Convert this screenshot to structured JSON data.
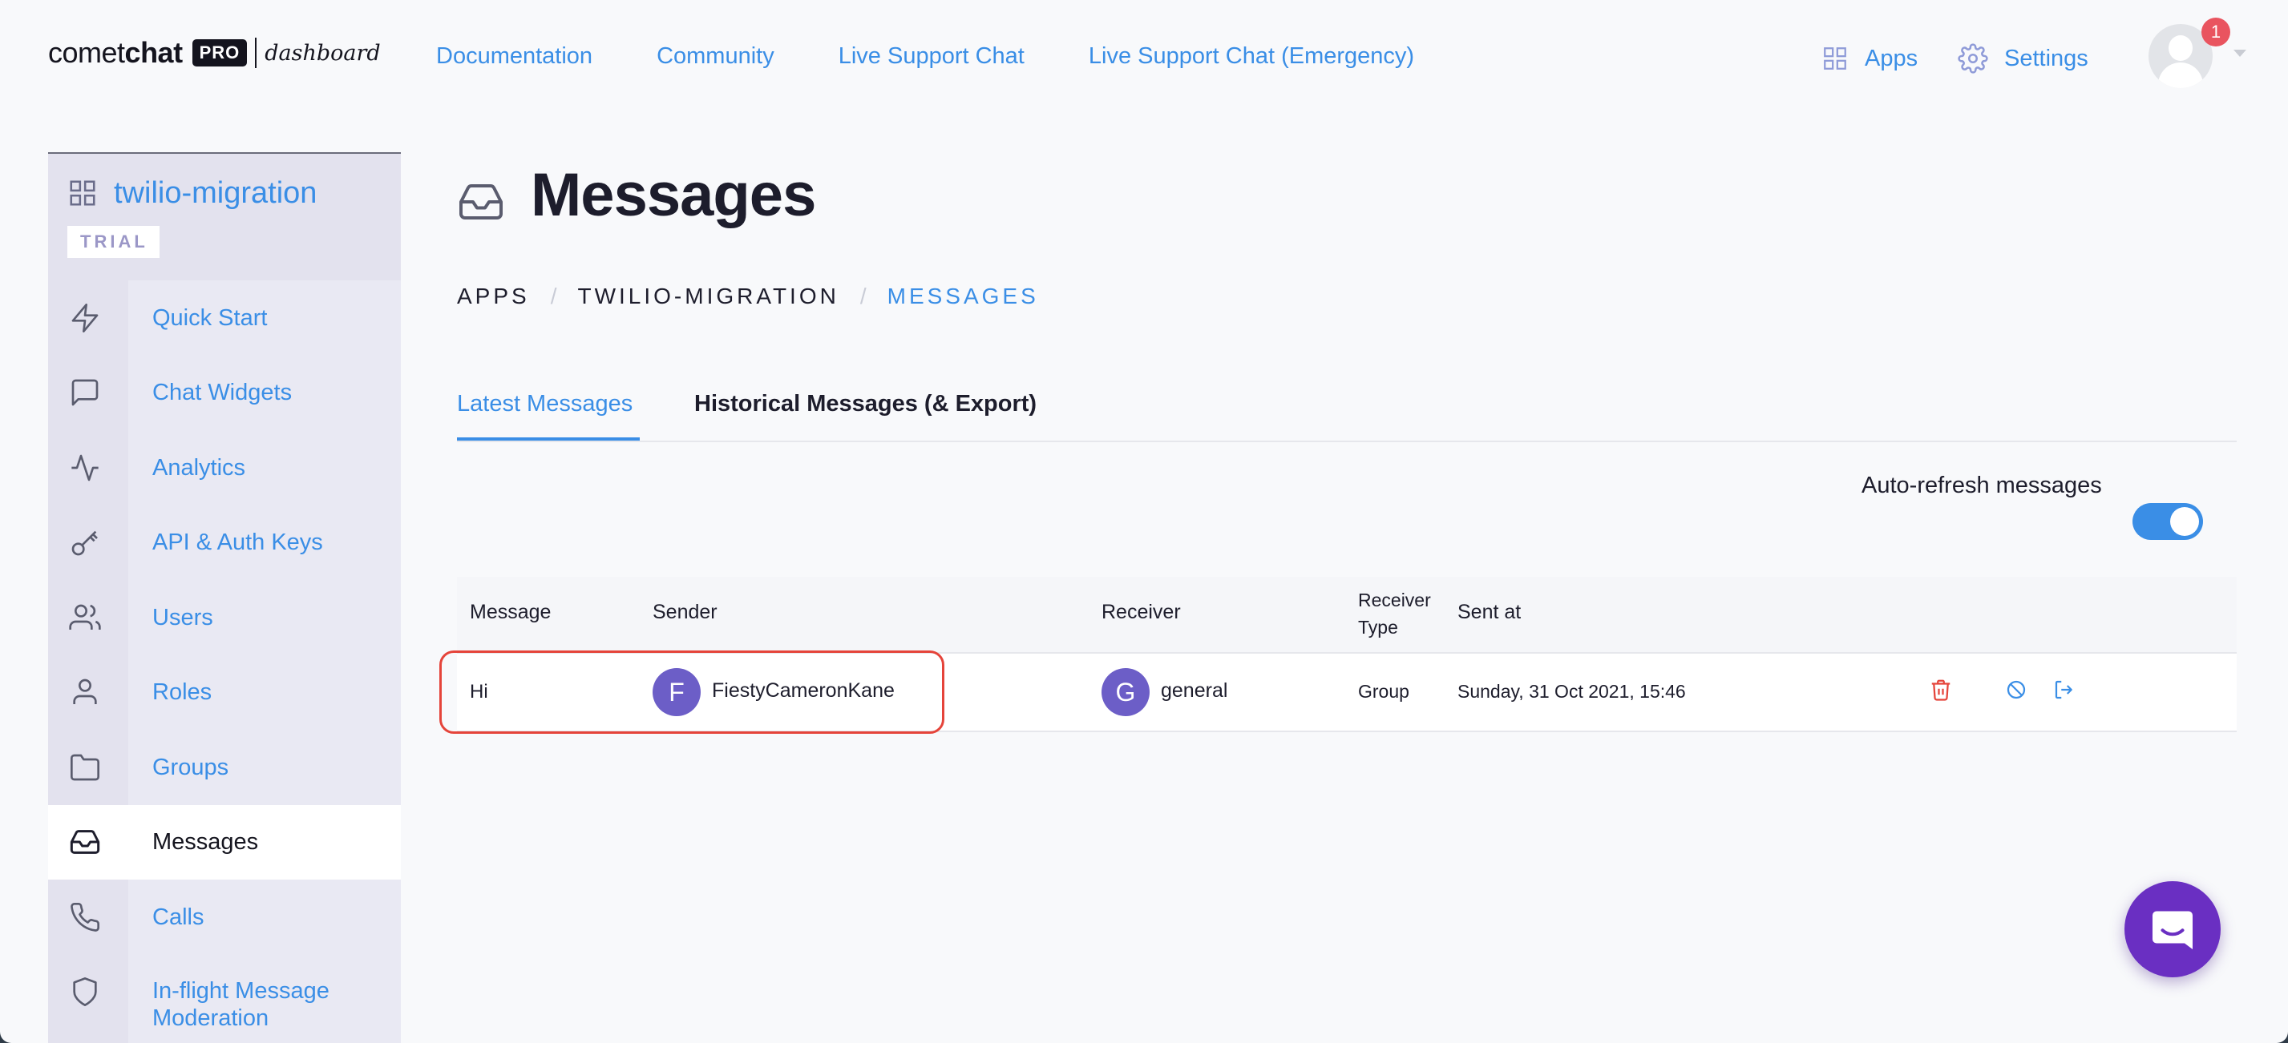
{
  "header": {
    "logo_text_light": "comet",
    "logo_text_bold": "chat",
    "logo_badge": "PRO",
    "logo_suffix": "dashboard",
    "nav": [
      "Documentation",
      "Community",
      "Live Support Chat",
      "Live Support Chat (Emergency)"
    ],
    "apps_label": "Apps",
    "settings_label": "Settings",
    "notification_count": "1"
  },
  "sidebar": {
    "app_name": "twilio-migration",
    "plan_badge": "TRIAL",
    "items": [
      {
        "label": "Quick Start",
        "icon": "lightning-icon"
      },
      {
        "label": "Chat Widgets",
        "icon": "chat-bubble-icon"
      },
      {
        "label": "Analytics",
        "icon": "activity-icon"
      },
      {
        "label": "API & Auth Keys",
        "icon": "key-icon"
      },
      {
        "label": "Users",
        "icon": "users-icon"
      },
      {
        "label": "Roles",
        "icon": "user-icon"
      },
      {
        "label": "Groups",
        "icon": "folder-icon"
      },
      {
        "label": "Messages",
        "icon": "inbox-icon",
        "active": true
      },
      {
        "label": "Calls",
        "icon": "phone-icon"
      },
      {
        "label": "In-flight Message Moderation",
        "icon": "shield-icon"
      }
    ]
  },
  "main": {
    "title": "Messages",
    "breadcrumb": [
      "APPS",
      "TWILIO-MIGRATION",
      "MESSAGES"
    ],
    "tabs": [
      "Latest Messages",
      "Historical Messages (& Export)"
    ],
    "active_tab": 0,
    "auto_refresh_label": "Auto-refresh messages",
    "auto_refresh_on": true,
    "table": {
      "headers": [
        "Message",
        "Sender",
        "Receiver",
        "Receiver Type",
        "Sent at"
      ],
      "rows": [
        {
          "message": "Hi",
          "sender_initial": "F",
          "sender": "FiestyCameronKane",
          "receiver_initial": "G",
          "receiver": "general",
          "receiver_type": "Group",
          "sent_at": "Sunday, 31 Oct 2021, 15:46"
        }
      ]
    }
  },
  "colors": {
    "accent": "#3a8ee6",
    "avatar": "#6c5ec7",
    "danger": "#e5443a",
    "launcher": "#6a2fc2"
  }
}
